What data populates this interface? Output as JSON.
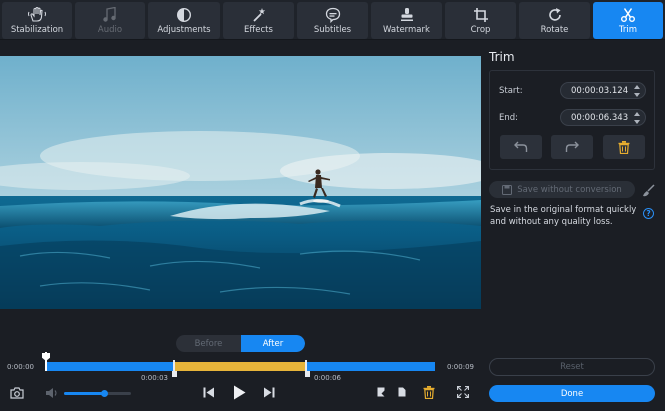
{
  "tabs": [
    {
      "label": "Stabilization",
      "icon": "hand-icon",
      "state": "normal"
    },
    {
      "label": "Audio",
      "icon": "music-note-icon",
      "state": "disabled"
    },
    {
      "label": "Adjustments",
      "icon": "contrast-icon",
      "state": "normal"
    },
    {
      "label": "Effects",
      "icon": "magic-wand-icon",
      "state": "normal"
    },
    {
      "label": "Subtitles",
      "icon": "speech-bubble-icon",
      "state": "normal"
    },
    {
      "label": "Watermark",
      "icon": "stamp-icon",
      "state": "normal"
    },
    {
      "label": "Crop",
      "icon": "crop-icon",
      "state": "normal"
    },
    {
      "label": "Rotate",
      "icon": "rotate-icon",
      "state": "normal"
    },
    {
      "label": "Trim",
      "icon": "scissors-icon",
      "state": "active"
    }
  ],
  "panel": {
    "title": "Trim",
    "start_label": "Start:",
    "start_value": "00:00:03.124",
    "end_label": "End:",
    "end_value": "00:00:06.343",
    "save_without_conversion": "Save without conversion",
    "save_description": "Save in the original format quickly and without any quality loss.",
    "help": "?",
    "reset": "Reset",
    "done": "Done"
  },
  "toggle": {
    "before": "Before",
    "after": "After",
    "selected": "After"
  },
  "timeline": {
    "start_time": "0:00:00",
    "end_time": "0:00:09",
    "trim_start_label": "0:00:03",
    "trim_end_label": "0:00:06",
    "volume_level": 0.57
  },
  "colors": {
    "accent": "#1787f2",
    "trim_segment": "#e7b43a",
    "delete_icon": "#e6ad2f"
  }
}
